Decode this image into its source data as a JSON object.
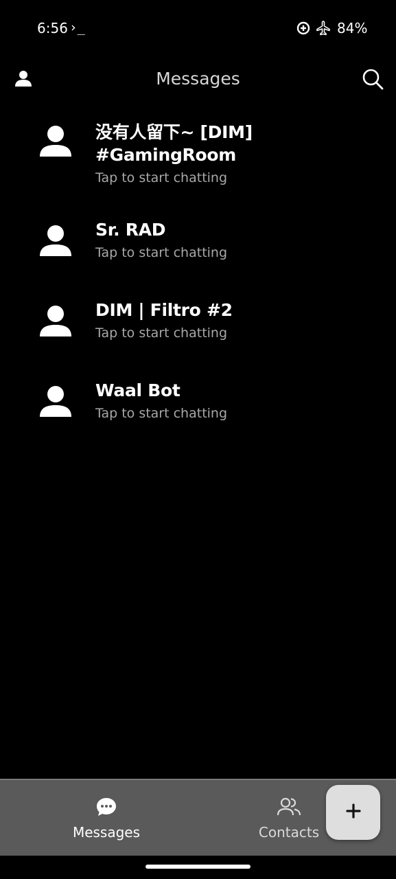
{
  "status_bar": {
    "time": "6:56",
    "terminal_glyph": "›_",
    "battery": "84%",
    "icons": [
      "terminal-icon",
      "data-saver-icon",
      "airplane-icon"
    ]
  },
  "top_bar": {
    "title": "Messages",
    "icons": [
      "profile-icon",
      "search-icon"
    ]
  },
  "conversations": [
    {
      "name": "没有人留下~ [DIM] #GamingRoom",
      "subtitle": "Tap to start chatting"
    },
    {
      "name": "Sr. RAD",
      "subtitle": "Tap to start chatting"
    },
    {
      "name": "DIM | Filtro #2",
      "subtitle": "Tap to start chatting"
    },
    {
      "name": "Waal Bot",
      "subtitle": "Tap to start chatting"
    }
  ],
  "bottom_nav": {
    "items": [
      {
        "label": "Messages",
        "icon": "chat-bubble-icon",
        "selected": true
      },
      {
        "label": "Contacts",
        "icon": "contacts-icon",
        "selected": false
      }
    ]
  },
  "fab": {
    "icon": "plus-icon"
  },
  "colors": {
    "background": "#000000",
    "nav_background": "#5a5a5a",
    "fab_background": "#dedede",
    "subtitle": "#a8a8a8"
  }
}
